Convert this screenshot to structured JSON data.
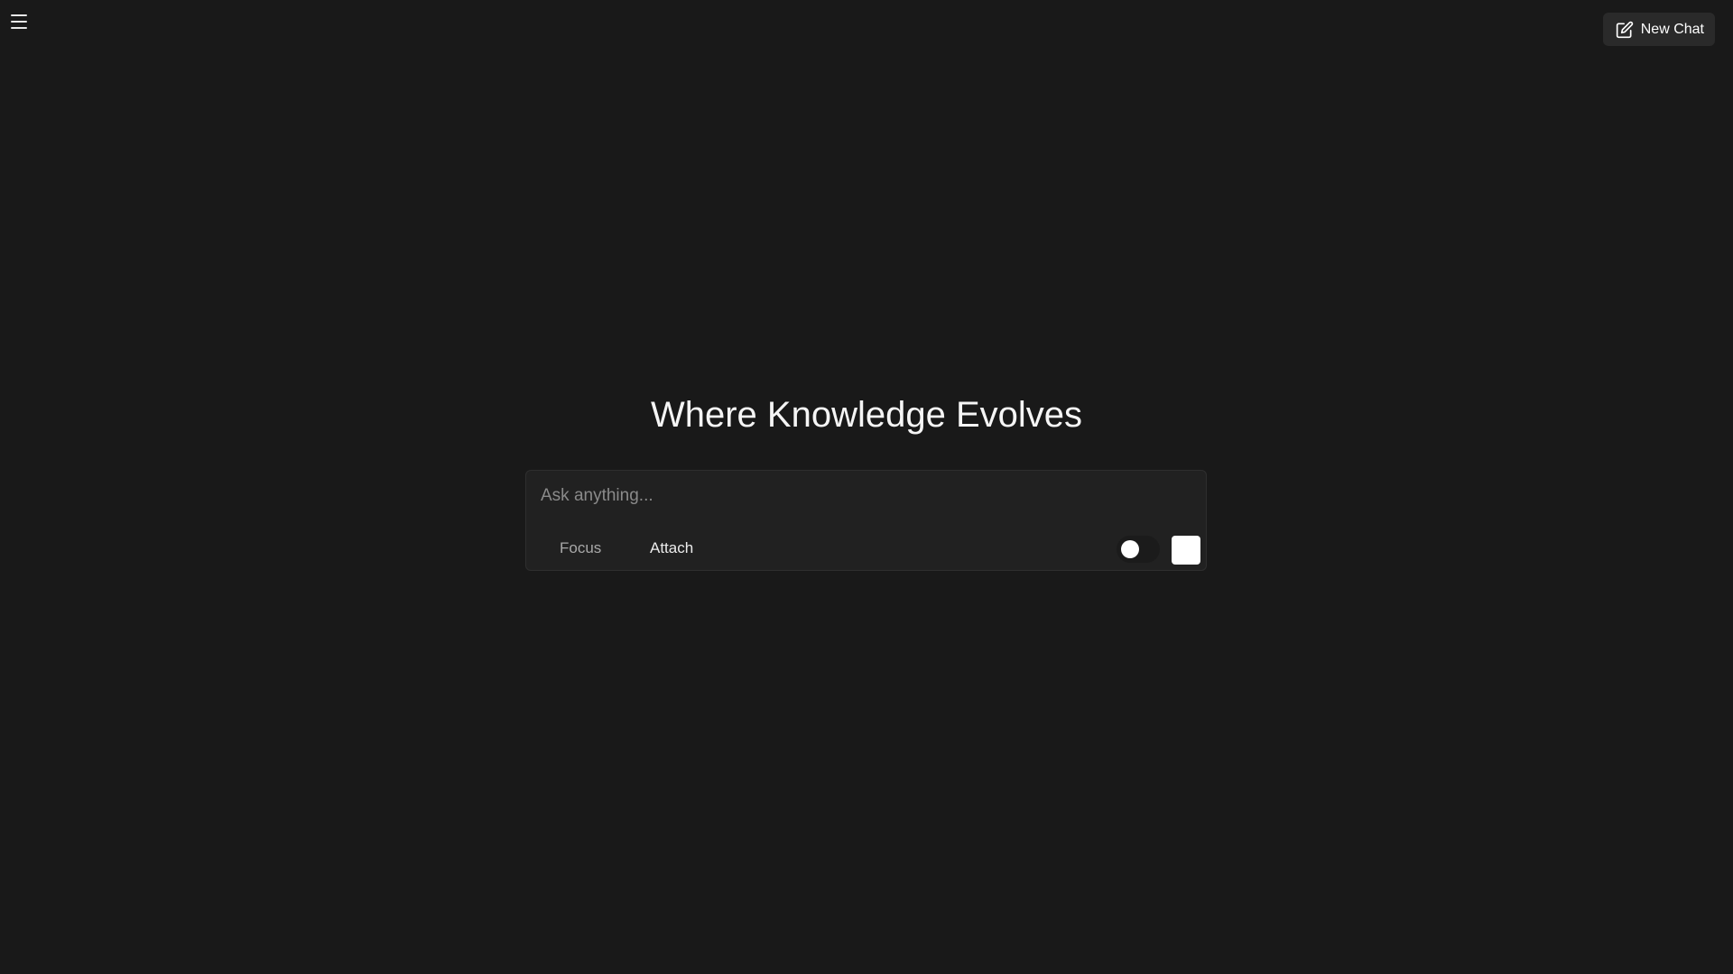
{
  "header": {
    "menu_icon": "hamburger-menu-icon",
    "new_chat": {
      "icon": "edit-icon",
      "label": "New Chat"
    }
  },
  "hero": {
    "title": "Where Knowledge Evolves"
  },
  "composer": {
    "placeholder": "Ask anything...",
    "value": "",
    "focus_label": "Focus",
    "attach_label": "Attach",
    "toggle_on": false,
    "send_icon": "send-icon"
  },
  "colors": {
    "background": "#191919",
    "composer_background": "#212121",
    "button_background": "#2a2a2a"
  }
}
